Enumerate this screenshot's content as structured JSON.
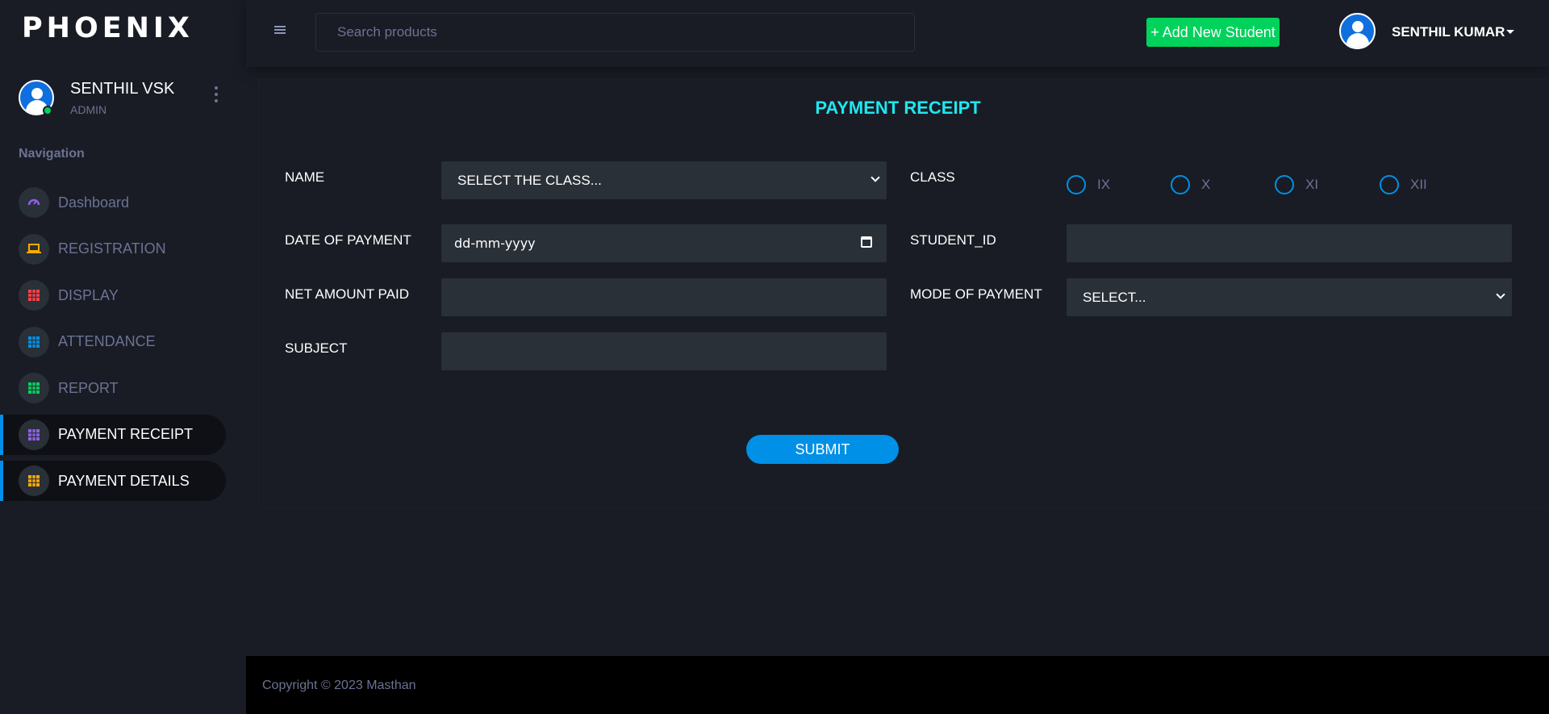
{
  "brand": {
    "name": "PHOENIX"
  },
  "sidebar": {
    "profile": {
      "name": "SENTHIL VSK",
      "role": "ADMIN"
    },
    "nav_heading": "Navigation",
    "items": [
      {
        "label": "Dashboard",
        "icon": "speedometer-icon",
        "color": "#8f5fe8"
      },
      {
        "label": "REGISTRATION",
        "icon": "laptop-icon",
        "color": "#ffab00"
      },
      {
        "label": "DISPLAY",
        "icon": "grid-icon",
        "color": "#fc424a"
      },
      {
        "label": "ATTENDANCE",
        "icon": "grid-icon",
        "color": "#0090e7"
      },
      {
        "label": "REPORT",
        "icon": "grid-icon",
        "color": "#00d25b"
      },
      {
        "label": "PAYMENT RECEIPT",
        "icon": "grid-icon",
        "color": "#8f5fe8",
        "active": true
      },
      {
        "label": "PAYMENT DETAILS",
        "icon": "grid-icon",
        "color": "#ffab00",
        "active": true
      }
    ]
  },
  "topbar": {
    "search_placeholder": "Search products",
    "add_button": "+ Add New Student",
    "user_name": "SENTHIL KUMAR"
  },
  "form": {
    "title": "PAYMENT RECEIPT",
    "name_label": "NAME",
    "name_select": "SELECT THE CLASS...",
    "class_label": "CLASS",
    "class_options": [
      "IX",
      "X",
      "XI",
      "XII"
    ],
    "date_label": "DATE OF PAYMENT",
    "date_placeholder": "dd-mm-yyyy",
    "student_id_label": "STUDENT_ID",
    "net_amount_label": "NET AMOUNT PAID",
    "mode_label": "MODE OF PAYMENT",
    "mode_select": "SELECT...",
    "subject_label": "SUBJECT",
    "submit": "SUBMIT"
  },
  "footer": {
    "copyright": "Copyright © 2023 Masthan"
  },
  "colors": {
    "accent": "#0090e7",
    "success": "#00d25b",
    "title": "#1ee7f0",
    "muted": "#6c7293"
  }
}
